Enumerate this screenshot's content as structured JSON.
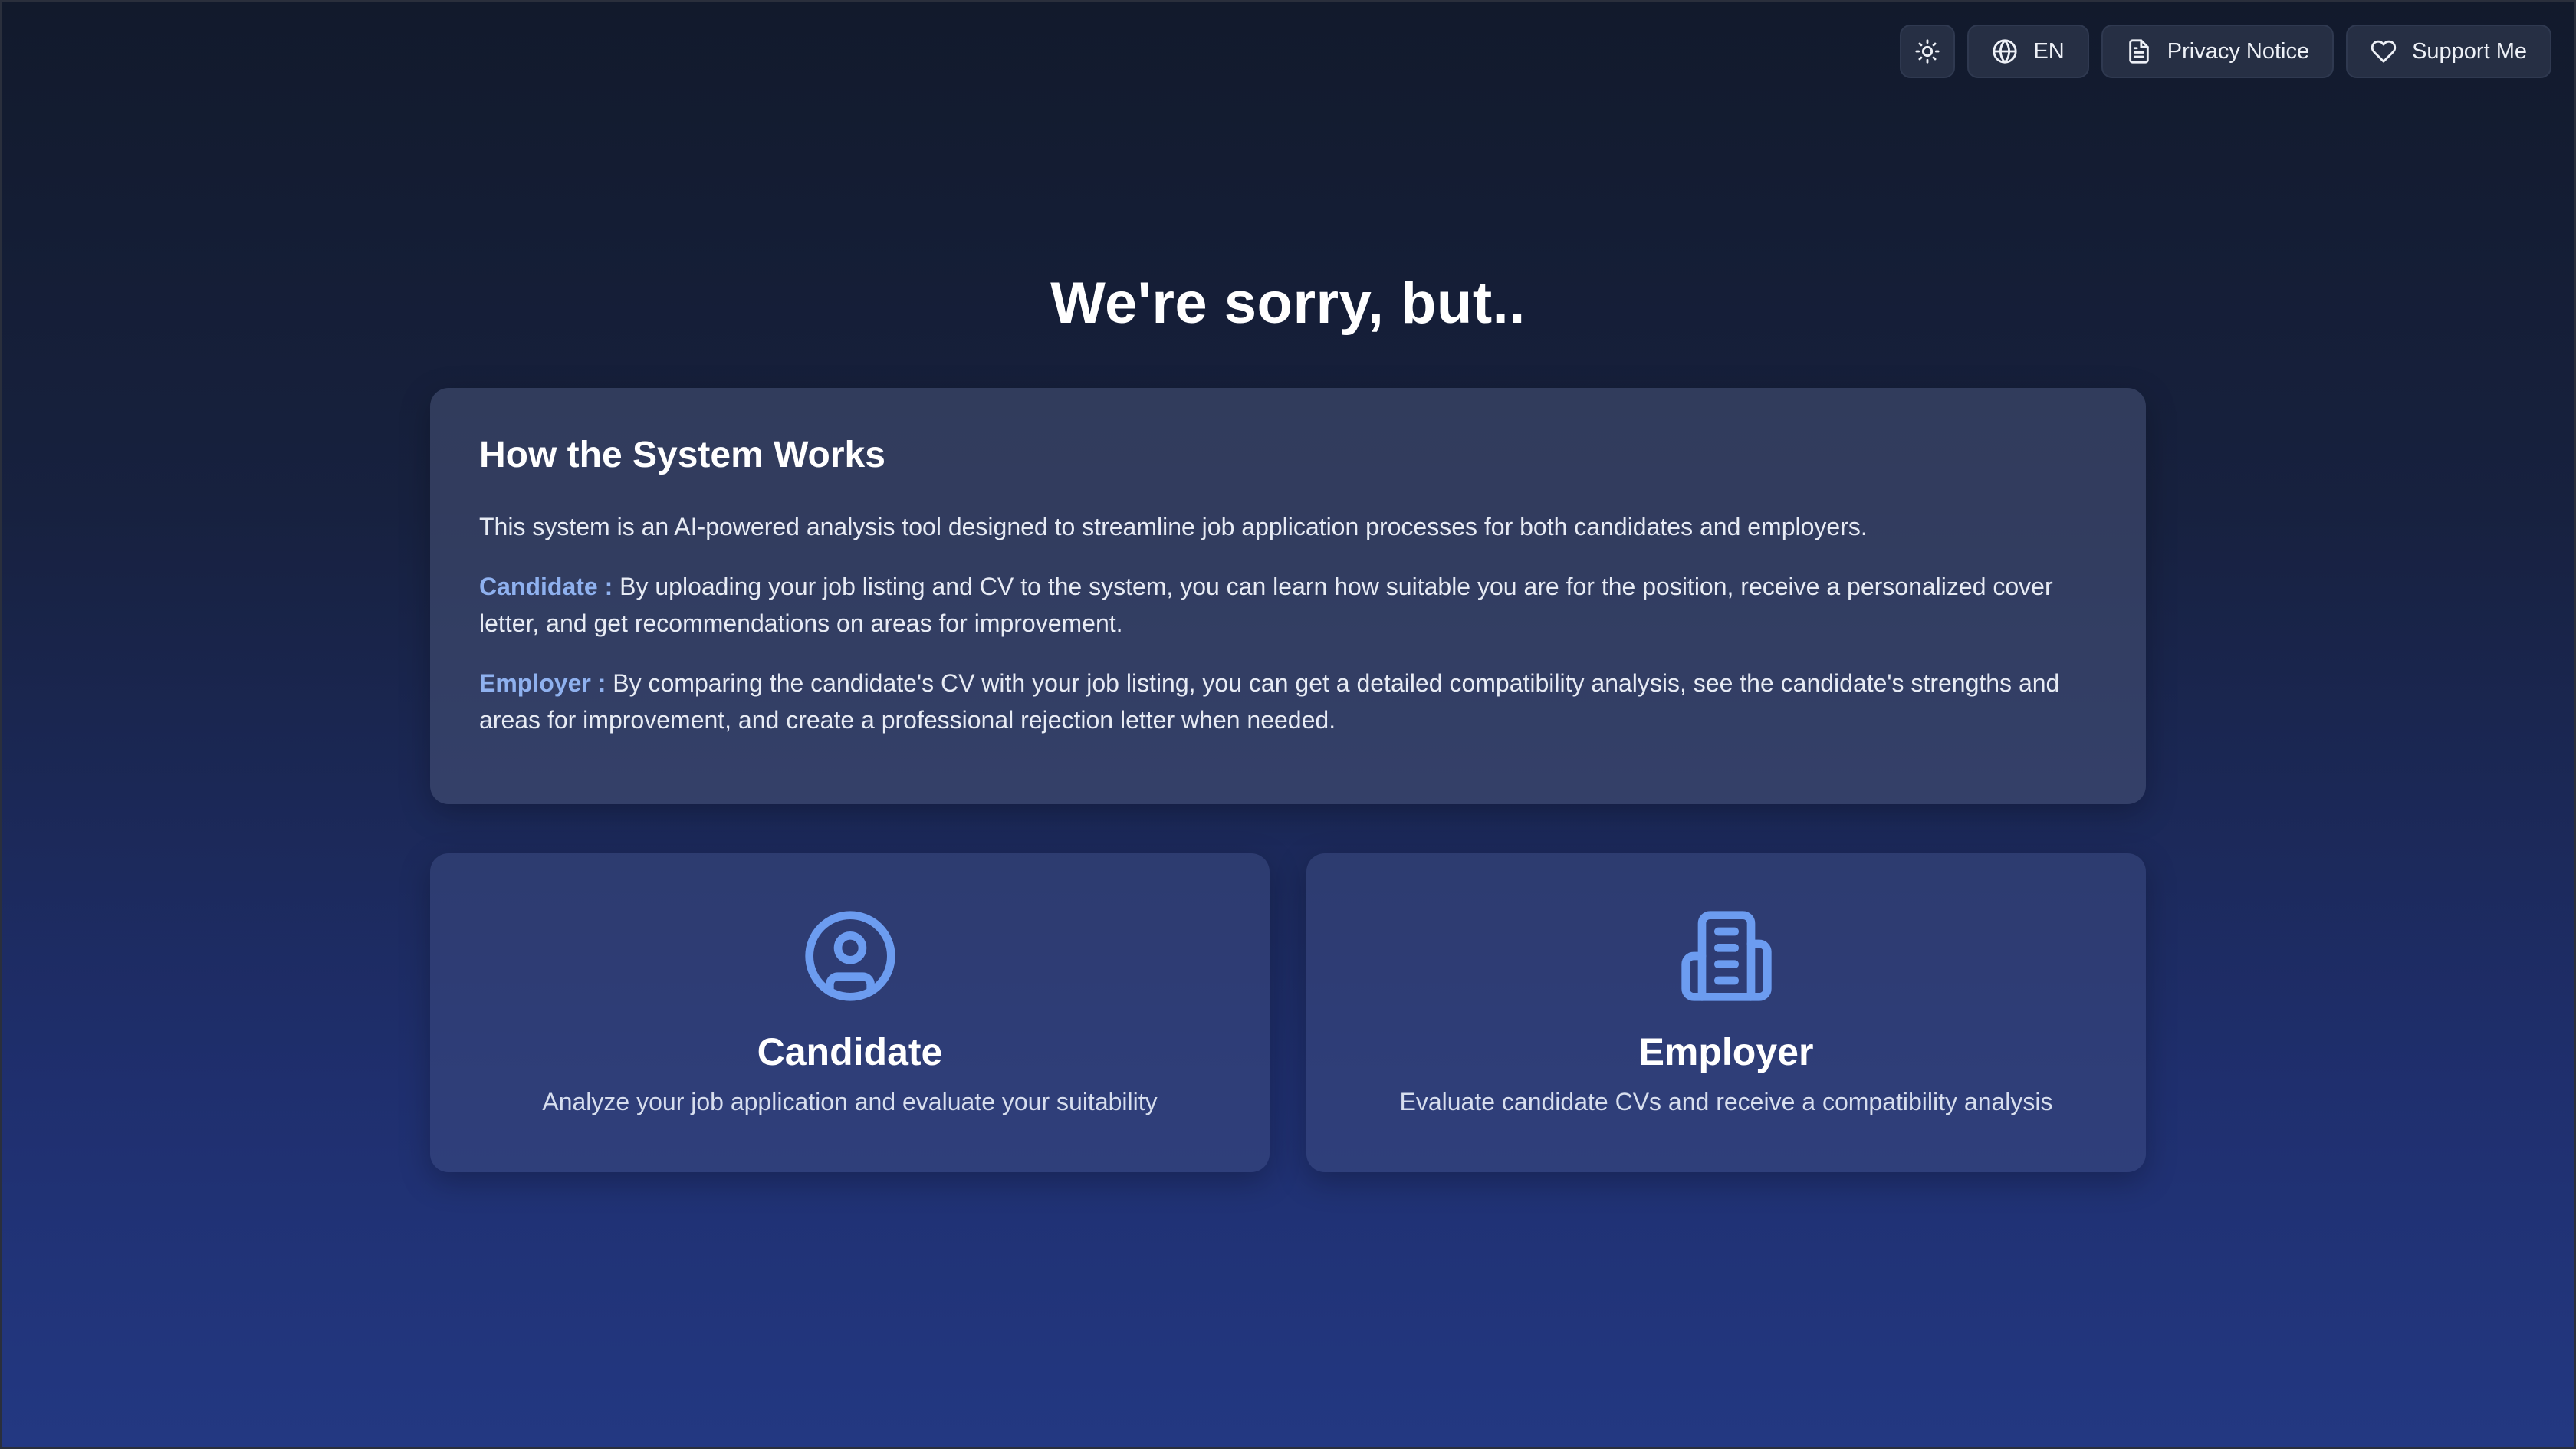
{
  "topbar": {
    "theme_icon": "sun-icon",
    "language_icon": "globe-icon",
    "language_label": "EN",
    "privacy_icon": "document-icon",
    "privacy_label": "Privacy Notice",
    "support_icon": "heart-icon",
    "support_label": "Support Me"
  },
  "page": {
    "title": "We're sorry, but.."
  },
  "info": {
    "heading": "How the System Works",
    "intro": "This system is an AI-powered analysis tool designed to streamline job application processes for both candidates and employers.",
    "candidate_label": "Candidate :",
    "candidate_text": "By uploading your job listing and CV to the system, you can learn how suitable you are for the position, receive a personalized cover letter, and get recommendations on areas for improvement.",
    "employer_label": "Employer :",
    "employer_text": "By comparing the candidate's CV with your job listing, you can get a detailed compatibility analysis, see the candidate's strengths and areas for improvement, and create a professional rejection letter when needed."
  },
  "roles": [
    {
      "icon": "user-circle-icon",
      "title": "Candidate",
      "description": "Analyze your job application and evaluate your suitability"
    },
    {
      "icon": "building-icon",
      "title": "Employer",
      "description": "Evaluate candidate CVs and receive a compatibility analysis"
    }
  ],
  "colors": {
    "accent": "#6c9cf0",
    "label": "#8fb1ef",
    "background_top": "#121a2c",
    "background_bottom": "#233882"
  }
}
